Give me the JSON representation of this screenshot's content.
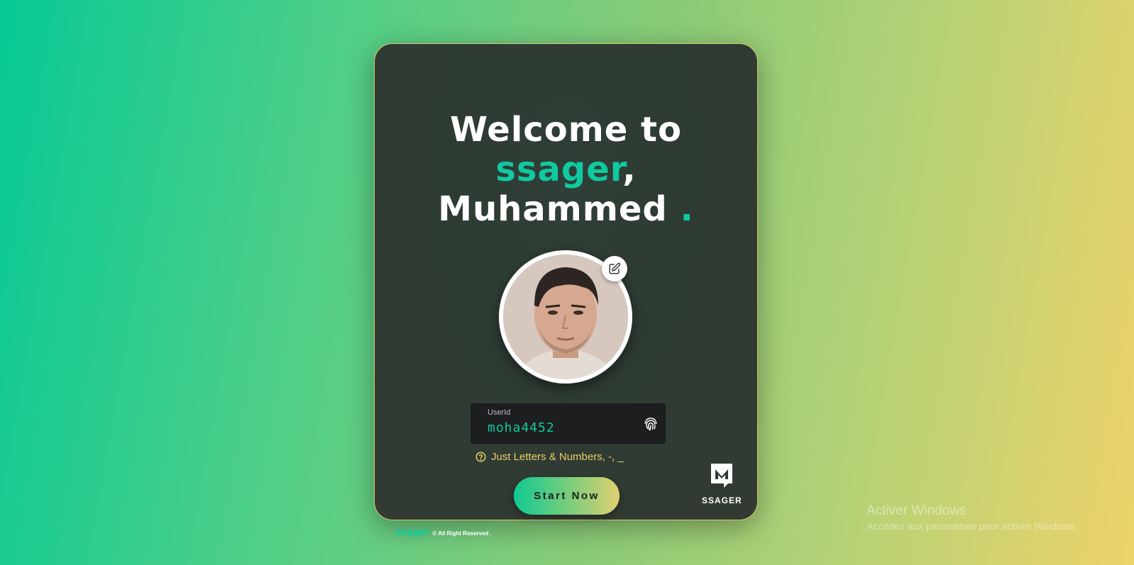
{
  "welcome": {
    "line1": "Welcome to",
    "brand": "ssager",
    "comma": ",",
    "name": "Muhammed",
    "dot": "."
  },
  "avatar": {
    "icon": "edit-icon"
  },
  "userid": {
    "label": "UserId",
    "value": "moha4452",
    "icon": "fingerprint-icon"
  },
  "hint": {
    "text": "Just Letters & Numbers, -, _",
    "icon": "help-circle-icon"
  },
  "start_button": {
    "label": "Start Now"
  },
  "logo": {
    "text": "SSAGER"
  },
  "footer": {
    "brand": "ssager",
    "text": "© All Right Reserved ."
  },
  "watermark": {
    "title": "Activer Windows",
    "subtitle": "Accédez aux paramètres pour activer Windows."
  },
  "colors": {
    "accent": "#0fc9a0",
    "hint": "#e9cf68",
    "field_bg": "#1d1e20"
  }
}
